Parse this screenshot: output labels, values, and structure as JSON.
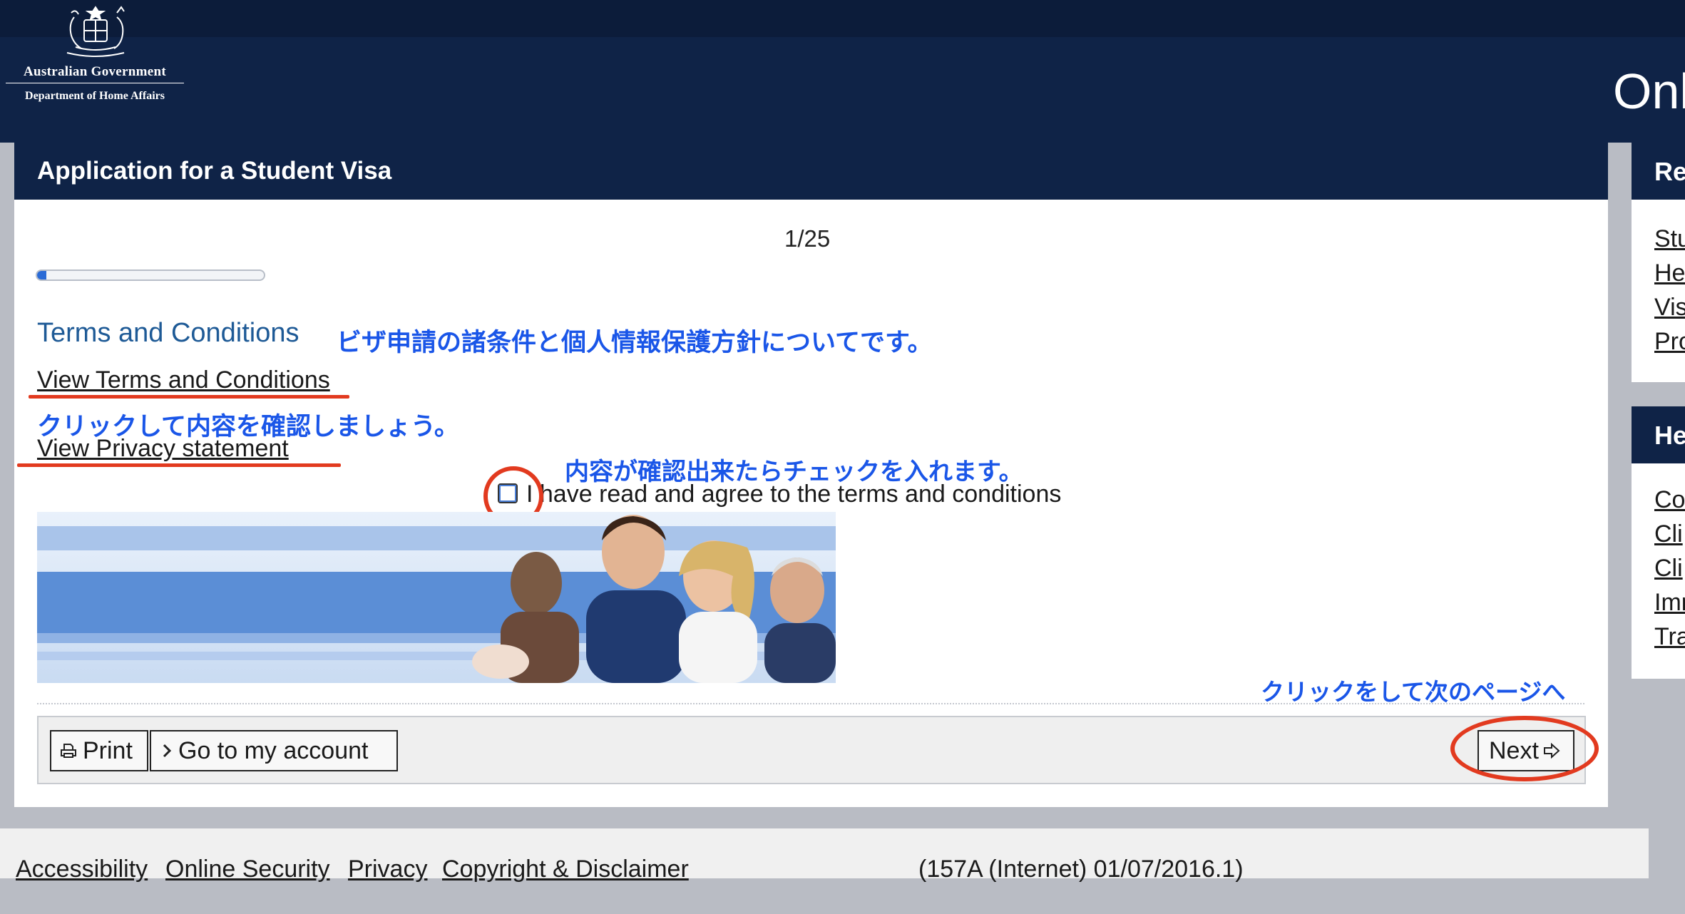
{
  "header": {
    "logo_line1": "Australian Government",
    "logo_line2": "Department of Home Affairs",
    "site_title": "Onl"
  },
  "form": {
    "title": "Application for a Student Visa",
    "page_counter": "1/25",
    "progress_fraction": 0.04,
    "section_heading": "Terms and Conditions",
    "view_terms_link": "View Terms and Conditions",
    "view_privacy_link": "View Privacy statement",
    "agree_label": "I have read and agree to the terms and conditions",
    "agree_checked": false
  },
  "annotations": {
    "heading_note": "ビザ申請の諸条件と個人情報保護方針についてです。",
    "links_note": "クリックして内容を確認しましょう。",
    "checkbox_note": "内容が確認出来たらチェックを入れます。",
    "next_note": "クリックをして次のページへ",
    "highlight_color": "#e23a1f",
    "note_color": "#1a56e8"
  },
  "buttons": {
    "print_label": "Print",
    "print_icon": "printer-icon",
    "account_label": "Go to my account",
    "account_icon": "chevron-right-icon",
    "next_label": "Next",
    "next_icon": "arrow-right-icon"
  },
  "sidebar": {
    "panel1_heading": "Re",
    "panel1_links": [
      "Stu",
      "He",
      "Vis",
      "Pro"
    ],
    "panel2_heading": "He",
    "panel2_links": [
      "Co",
      "Cli",
      "Cli",
      "Imm",
      "Tra"
    ]
  },
  "footer": {
    "links": [
      "Accessibility",
      "Online Security",
      "Privacy",
      "Copyright & Disclaimer"
    ],
    "version": "(157A (Internet) 01/07/2016.1)"
  },
  "colors": {
    "navy": "#0f2347",
    "heading_blue": "#1e5a96",
    "progress_blue": "#2a6bd6"
  }
}
